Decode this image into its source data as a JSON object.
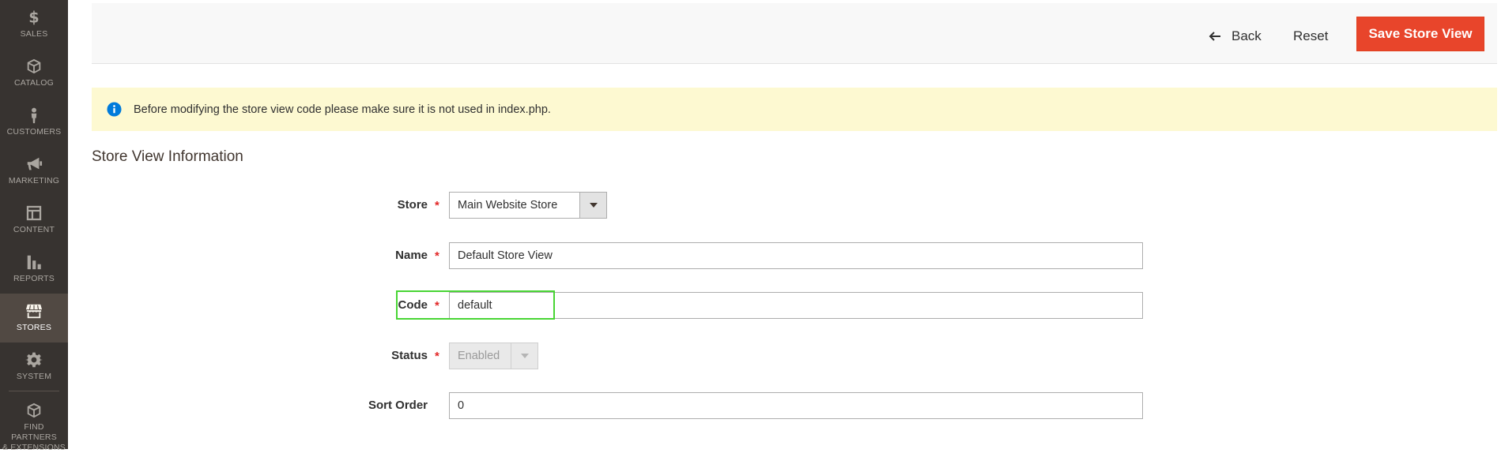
{
  "sidebar": {
    "items": [
      {
        "label": "SALES",
        "icon": "dollar-icon"
      },
      {
        "label": "CATALOG",
        "icon": "box-icon"
      },
      {
        "label": "CUSTOMERS",
        "icon": "person-icon"
      },
      {
        "label": "MARKETING",
        "icon": "megaphone-icon"
      },
      {
        "label": "CONTENT",
        "icon": "layout-icon"
      },
      {
        "label": "REPORTS",
        "icon": "bar-chart-icon"
      },
      {
        "label": "STORES",
        "icon": "storefront-icon",
        "active": true
      },
      {
        "label": "SYSTEM",
        "icon": "gear-icon"
      },
      {
        "label": "FIND PARTNERS\n& EXTENSIONS",
        "label_line1": "FIND PARTNERS",
        "label_line2": "& EXTENSIONS",
        "icon": "extensions-icon"
      }
    ]
  },
  "actions": {
    "back_label": "Back",
    "reset_label": "Reset",
    "save_label": "Save Store View"
  },
  "notice": {
    "text": "Before modifying the store view code please make sure it is not used in index.php."
  },
  "section": {
    "title": "Store View Information"
  },
  "form": {
    "store": {
      "label": "Store",
      "value": "Main Website Store",
      "required": "*"
    },
    "name": {
      "label": "Name",
      "value": "Default Store View",
      "required": "*"
    },
    "code": {
      "label": "Code",
      "value": "default",
      "required": "*"
    },
    "status": {
      "label": "Status",
      "value": "Enabled",
      "required": "*"
    },
    "sort_order": {
      "label": "Sort Order",
      "value": "0"
    }
  },
  "colors": {
    "sidebar_bg": "#373330",
    "sidebar_active": "#514943",
    "save_button": "#e8452b",
    "notice_bg": "#fdf9d1",
    "notice_icon": "#007bdb",
    "required": "#e22626",
    "highlight": "#48d534"
  }
}
